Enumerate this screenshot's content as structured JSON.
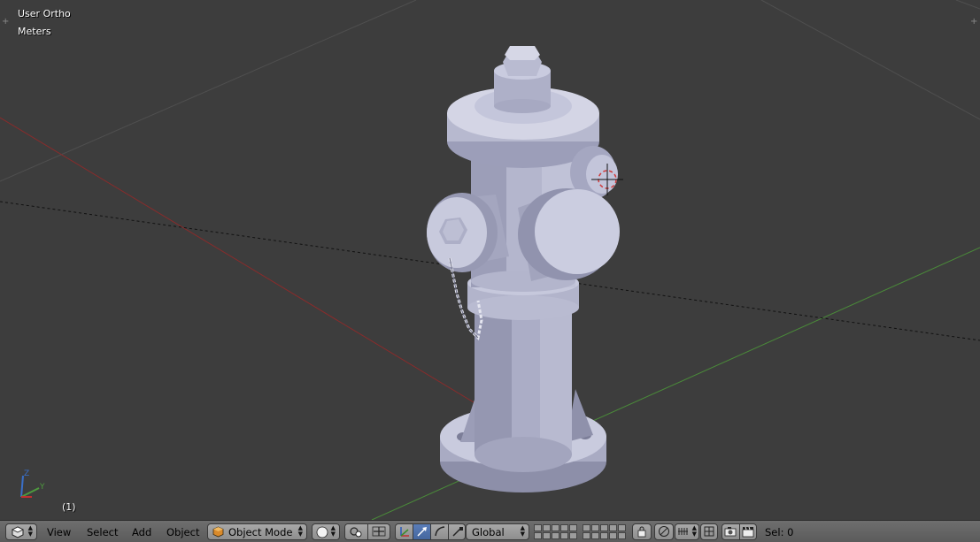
{
  "viewport": {
    "view_name": "User Ortho",
    "units": "Meters",
    "frame": "(1)",
    "background_color": "#3d3d3d",
    "gizmo": {
      "z_label": "Z",
      "y_label": "Y"
    },
    "object": "fire-hydrant",
    "colors": {
      "x_axis": "#8a2b2b",
      "y_axis": "#4a8a3a",
      "grid": "#505050",
      "mesh": "#b7b9cf",
      "mesh_shadow": "#8b8da8",
      "mesh_highlight": "#dcddea"
    }
  },
  "header": {
    "editor_type_icon": "3d-view-icon",
    "menus": [
      "View",
      "Select",
      "Add",
      "Object"
    ],
    "mode": {
      "icon": "cube-icon",
      "label": "Object Mode"
    },
    "shading_icon": "sphere-icon",
    "pivot_icon": "pivot-icon",
    "manipulator_icons": [
      "translate-icon",
      "rotate-icon",
      "scale-icon"
    ],
    "orientation": "Global",
    "layers_icon": "layers-grid",
    "lock_icon": "lock-icon",
    "proportional_icon": "proportional-icon",
    "snap_icon": "snap-icon",
    "render_icons": [
      "camera-icon",
      "clapper-icon"
    ],
    "status": "Sel: 0",
    "accent_color": "#5a7db8"
  }
}
